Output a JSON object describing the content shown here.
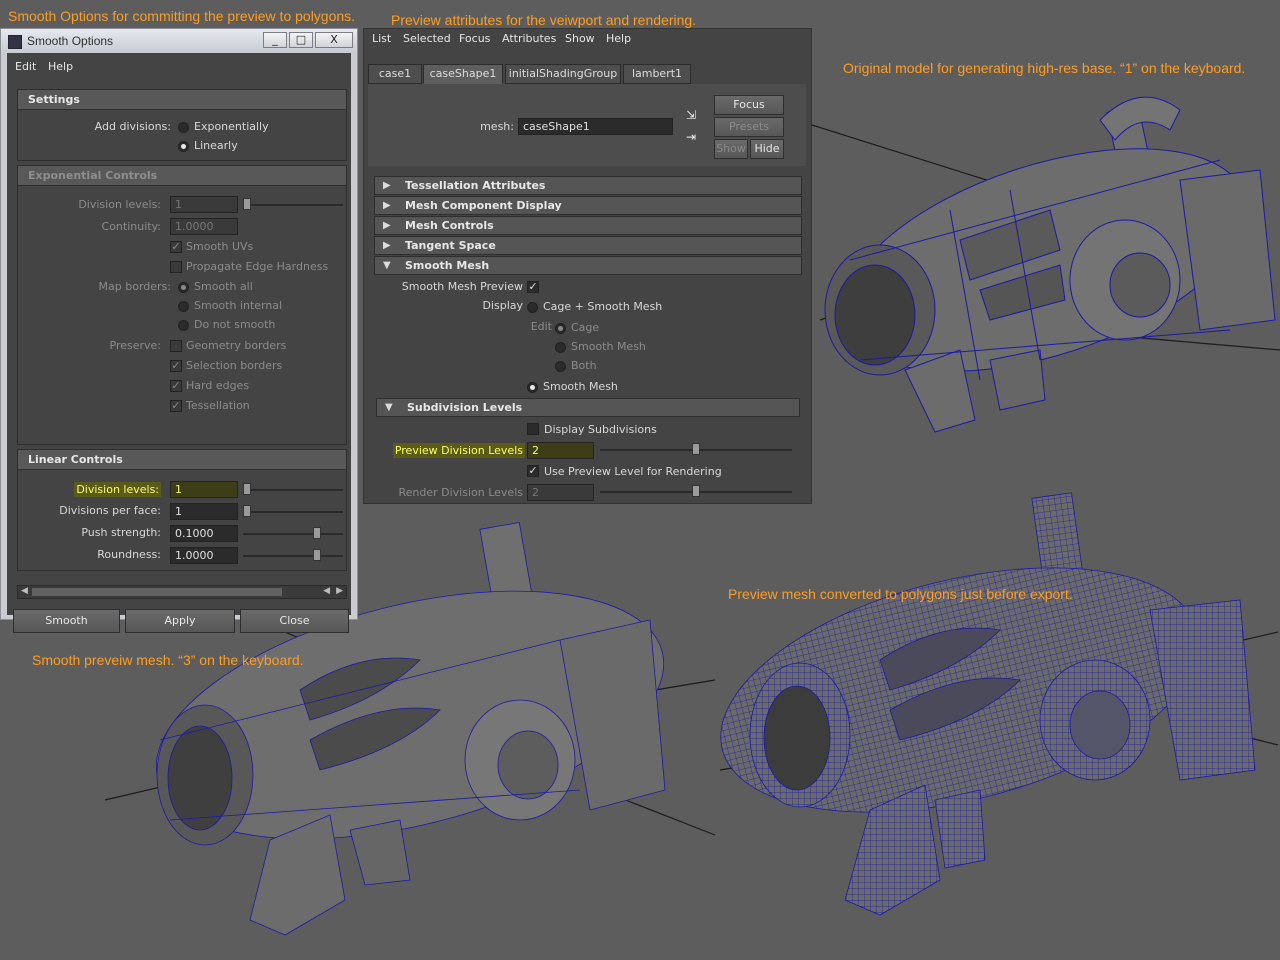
{
  "captions": {
    "smooth_options": "Smooth Options for committing the preview to polygons.",
    "preview_attributes": "Preview attributes for the veiwport and rendering.",
    "original_model": "Original model for generating high-res base. “1” on the keyboard.",
    "smooth_preview": "Smooth preveiw mesh. “3” on the keyboard.",
    "converted": "Preview mesh converted to polygons just before export."
  },
  "smooth_window": {
    "title": "Smooth Options",
    "title_buttons": [
      "_",
      "□",
      "X"
    ],
    "menu": [
      "Edit",
      "Help"
    ],
    "settings": {
      "header": "Settings",
      "add_divisions_label": "Add divisions:",
      "options": [
        "Exponentially",
        "Linearly"
      ],
      "selected": "Linearly"
    },
    "exponential": {
      "header": "Exponential Controls",
      "division_levels_label": "Division levels:",
      "division_levels_value": "1",
      "continuity_label": "Continuity:",
      "continuity_value": "1.0000",
      "smooth_uvs": "Smooth UVs",
      "propagate_edge": "Propagate Edge Hardness",
      "map_borders_label": "Map borders:",
      "map_borders_options": [
        "Smooth all",
        "Smooth internal",
        "Do not smooth"
      ],
      "preserve_label": "Preserve:",
      "preserve_options": [
        "Geometry borders",
        "Selection borders",
        "Hard edges",
        "Tessellation"
      ]
    },
    "linear": {
      "header": "Linear Controls",
      "division_levels_label": "Division levels:",
      "division_levels_value": "1",
      "divisions_per_face_label": "Divisions per face:",
      "divisions_per_face_value": "1",
      "push_strength_label": "Push strength:",
      "push_strength_value": "0.1000",
      "roundness_label": "Roundness:",
      "roundness_value": "1.0000"
    },
    "buttons": {
      "smooth": "Smooth",
      "apply": "Apply",
      "close": "Close"
    }
  },
  "attribute_editor": {
    "menu": [
      "List",
      "Selected",
      "Focus",
      "Attributes",
      "Show",
      "Help"
    ],
    "tabs": [
      "case1",
      "caseShape1",
      "initialShadingGroup",
      "lambert1"
    ],
    "active_tab": "caseShape1",
    "mesh_label": "mesh:",
    "mesh_value": "caseShape1",
    "side_buttons": {
      "focus": "Focus",
      "presets": "Presets",
      "show": "Show",
      "hide": "Hide"
    },
    "sections": [
      "Tessellation Attributes",
      "Mesh Component Display",
      "Mesh Controls",
      "Tangent Space",
      "Smooth Mesh"
    ],
    "smooth_mesh": {
      "preview_label": "Smooth Mesh Preview",
      "display_label": "Display",
      "display_option": "Cage + Smooth Mesh",
      "edit_label": "Edit",
      "edit_options": [
        "Cage",
        "Smooth Mesh",
        "Both"
      ],
      "smooth_mesh_option": "Smooth Mesh"
    },
    "subdivision": {
      "header": "Subdivision Levels",
      "display_subdivisions": "Display Subdivisions",
      "preview_levels_label": "Preview Division Levels",
      "preview_levels_value": "2",
      "use_preview_label": "Use Preview Level for Rendering",
      "render_levels_label": "Render Division Levels",
      "render_levels_value": "2"
    }
  },
  "colors": {
    "caption": "#ff9d1f",
    "wire": "#1a1aa8",
    "highlight": "#ffff66"
  }
}
